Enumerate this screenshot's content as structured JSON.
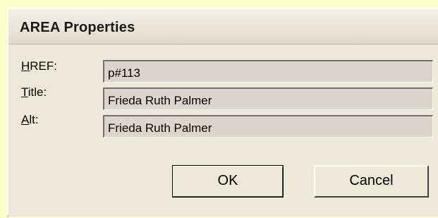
{
  "dialog": {
    "title": "AREA Properties"
  },
  "fields": {
    "href": {
      "label_accel": "H",
      "label_rest": "REF:",
      "value": "p#113"
    },
    "title": {
      "label_accel": "T",
      "label_rest": "itle:",
      "value": "Frieda Ruth Palmer"
    },
    "alt": {
      "label_accel": "A",
      "label_rest": "lt:",
      "value": "Frieda Ruth Palmer"
    }
  },
  "buttons": {
    "ok_label": "OK",
    "cancel_label": "Cancel"
  }
}
